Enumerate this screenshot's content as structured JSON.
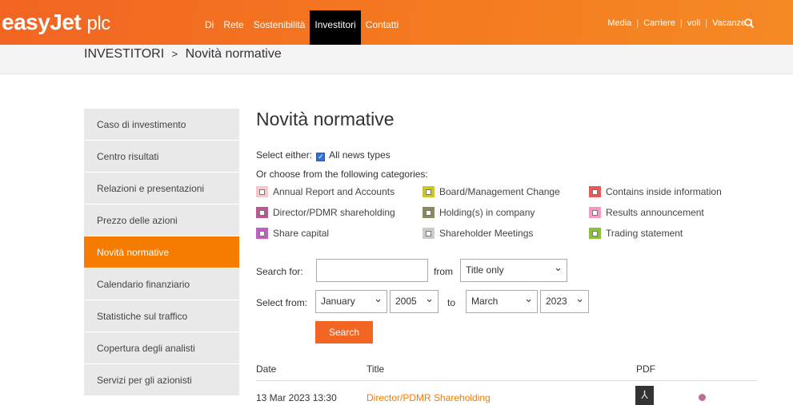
{
  "header": {
    "logo": "easyJet",
    "logo_suffix": "plc",
    "nav": [
      "Di",
      "Rete",
      "Sostenibilità",
      "Investitori",
      "Contatti"
    ],
    "active_nav": "Investitori",
    "utility": [
      "Media",
      "Carriere",
      "voli",
      "Vacanze"
    ]
  },
  "breadcrumb": {
    "root": "INVESTITORI",
    "sep": ">",
    "current": "Novità normative"
  },
  "sidebar": {
    "items": [
      "Caso di investimento",
      "Centro risultati",
      "Relazioni e presentazioni",
      "Prezzo delle azioni",
      "Novità normative",
      "Calendario finanziario",
      "Statistiche sul traffico",
      "Copertura degli analisti",
      "Servizi per gli azionisti"
    ],
    "active": "Novità normative"
  },
  "main": {
    "title": "Novità normative",
    "select_either": "Select either:",
    "all_news": "All news types",
    "all_news_checked": true,
    "choose": "Or choose from the following categories:",
    "categories": [
      {
        "label": "Annual Report and Accounts",
        "color": "#f7c8cc"
      },
      {
        "label": "Board/Management Change",
        "color": "#c8c82a"
      },
      {
        "label": "Contains inside information",
        "color": "#e85a5a"
      },
      {
        "label": "Director/PDMR shareholding",
        "color": "#b85a90"
      },
      {
        "label": "Holding(s) in company",
        "color": "#8a8a62"
      },
      {
        "label": "Results announcement",
        "color": "#f29ac4"
      },
      {
        "label": "Share capital",
        "color": "#c060c0"
      },
      {
        "label": "Shareholder Meetings",
        "color": "#cccccc"
      },
      {
        "label": "Trading statement",
        "color": "#8cc03a"
      }
    ],
    "search_for": "Search for:",
    "search_value": "",
    "from": "from",
    "scope": "Title only",
    "select_from": "Select from:",
    "from_month": "January",
    "from_year": "2005",
    "to": "to",
    "to_month": "March",
    "to_year": "2023",
    "search_button": "Search"
  },
  "table": {
    "headers": [
      "Date",
      "Title",
      "PDF"
    ],
    "rows": [
      {
        "date": "13 Mar 2023 13:30",
        "title": "Director/PDMR Shareholding",
        "dot_color": "#c06aa0"
      }
    ]
  }
}
